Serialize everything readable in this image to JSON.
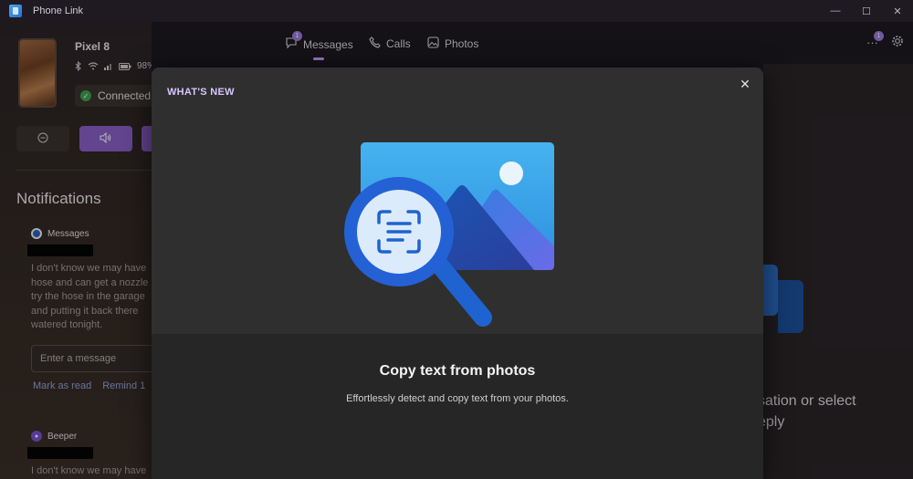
{
  "window": {
    "title": "Phone Link",
    "controls": {
      "minimize": "—",
      "maximize": "☐",
      "close": "✕"
    }
  },
  "device": {
    "name": "Pixel 8",
    "battery": "98%",
    "connection_status": "Connected"
  },
  "notifications": {
    "heading": "Notifications",
    "items": [
      {
        "app": "Messages",
        "body": "I don't know we may have hose and can get a nozzle try the hose in the garage and putting it back there watered tonight."
      },
      {
        "app": "Beeper",
        "body": "I don't know we may have"
      }
    ],
    "reply_placeholder": "Enter a message",
    "actions": {
      "mark_read": "Mark as read",
      "remind": "Remind 1"
    }
  },
  "nav": {
    "tabs": [
      {
        "label": "Messages",
        "badge": "1",
        "active": true
      },
      {
        "label": "Calls"
      },
      {
        "label": "Photos"
      }
    ],
    "more_badge": "1"
  },
  "right_pane": {
    "line1": "sation or select",
    "line2": "eply"
  },
  "modal": {
    "eyebrow": "WHAT'S NEW",
    "title": "Copy text from photos",
    "description": "Effortlessly detect and copy text from your photos.",
    "close_label": "✕"
  },
  "colors": {
    "accent": "#8a5fc7",
    "modal_eyebrow": "#d8c7ff",
    "connected": "#3fa34d",
    "link": "#8fa2d8"
  }
}
